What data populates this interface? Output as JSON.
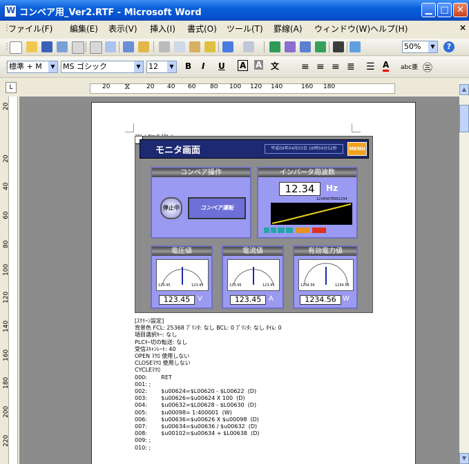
{
  "window": {
    "title": "コンベア用_Ver2.RTF - Microsoft Word"
  },
  "menu": [
    "ファイル(F)",
    "編集(E)",
    "表示(V)",
    "挿入(I)",
    "書式(O)",
    "ツール(T)",
    "罫線(A)",
    "ウィンドウ(W)",
    "ヘルプ(H)"
  ],
  "toolbar": {
    "zoom": "50%"
  },
  "format_bar": {
    "style": "標準 + M",
    "font": "MS ゴシック",
    "size": "12"
  },
  "ruler": {
    "h_marks": [
      "20",
      "20",
      "40",
      "60",
      "80",
      "100",
      "120",
      "140",
      "160",
      "180"
    ],
    "v_marks": [
      "20",
      "20",
      "40",
      "60",
      "80",
      "100",
      "120",
      "140",
      "160",
      "180",
      "200",
      "220"
    ]
  },
  "doc": {
    "header_line": "ｽｸﾘｰﾝ No:0  ｽｸﾘｰﾝ",
    "screen": {
      "title": "モニタ画面",
      "datetime": "平成09年04月03日 16時59分52秒",
      "menu_button": "MENU",
      "conveyor_header": "コンベア操作",
      "stop_label": "停止中",
      "run_label": "コンベア運転",
      "inverter_header": "インバータ周波数",
      "inverter_value": "12.34",
      "inverter_unit": "Hz",
      "graph_value": "12345678901234",
      "voltage_header": "電圧値",
      "current_header": "電流値",
      "power_header": "有効電力値",
      "voltage_value": "123.45",
      "voltage_unit": "V",
      "current_value": "123.45",
      "current_unit": "A",
      "power_value": "1234.56",
      "power_unit": "W",
      "gauge1_lo": "123.45",
      "gauge1_hi": "123.45",
      "gauge2_lo": "123.45",
      "gauge2_hi": "123.45",
      "gauge3_lo": "1234.56",
      "gauge3_hi": "1234.56"
    },
    "notes": [
      "[ｽｸﾘｰﾝ設定]",
      "背景色 FCL: 25368 ﾌﾟﾘﾝﾀ: なし BCL: 0 ﾌﾟﾘﾝﾀ: なし ﾀｲﾑ: 0",
      "項目選択ｷｰ: なし",
      "PLCｷｰ切の転送: なし",
      "受信ｽｷｬﾝﾚｰﾄ: 40",
      "OPEN ﾏｸﾛ 使用しない",
      "CLOSEﾏｸﾛ 使用しない",
      "CYCLEﾏｸﾛ",
      "000:        RET",
      "001: ;",
      "002:        $u00624=$L00620 - $L00622  (D)",
      "003:        $u00626=$u00624 X 100  (D)",
      "004:        $u00632=$L00628 - $L00630  (D)",
      "005:        $u00098= 1:400001  (W)",
      "006:        $u00636=$u00626 X $u00098  (D)",
      "007:        $u00634=$u00636 / $u00632  (D)",
      "008:        $u00102=$u00634 + $L00638  (D)",
      "009: ;",
      "010: ;"
    ]
  }
}
